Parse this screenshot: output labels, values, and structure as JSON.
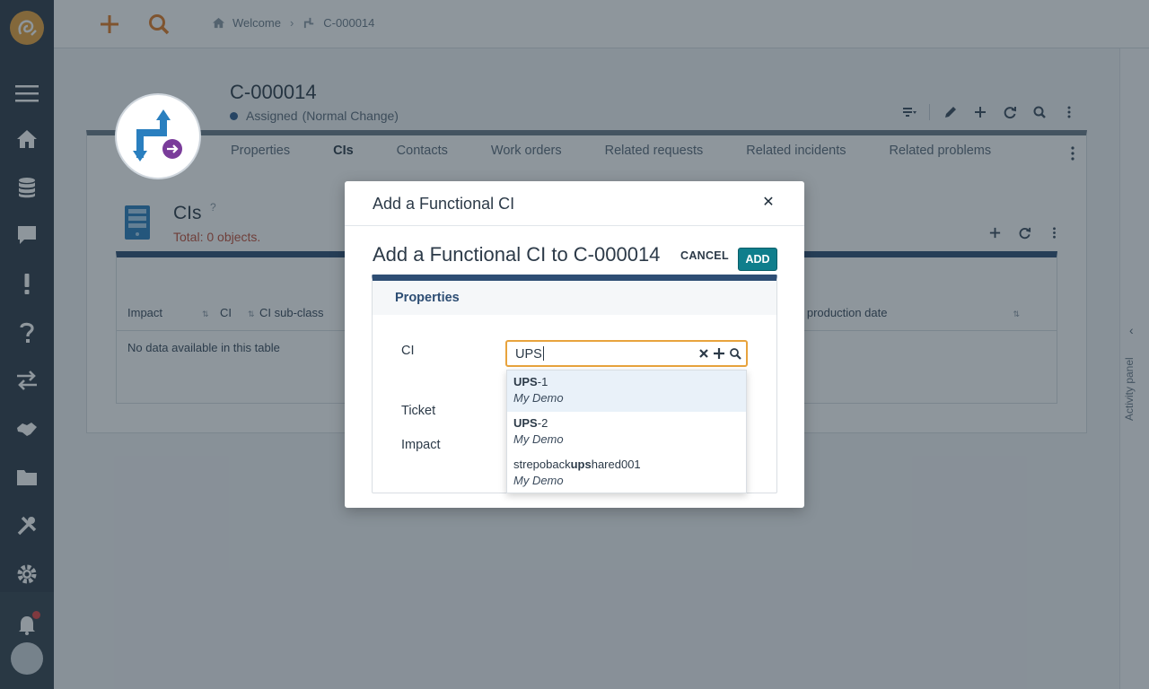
{
  "sidebar": {
    "items": [
      "menu-icon",
      "home-icon",
      "database-icon",
      "chat-icon",
      "alert-icon",
      "help-icon",
      "swap-icon",
      "handshake-icon",
      "folder-icon",
      "tools-icon",
      "gear-icon"
    ],
    "bottom": [
      "bell-icon",
      "avatar"
    ]
  },
  "topbar": {
    "breadcrumb": [
      {
        "label": "Welcome",
        "icon": "home-icon"
      },
      {
        "label": "C-000014",
        "icon": "change-icon"
      }
    ]
  },
  "object": {
    "title": "C-000014",
    "status": "Assigned",
    "status_detail": "(Normal Change)",
    "tabs": [
      "Properties",
      "CIs",
      "Contacts",
      "Work orders",
      "Related requests",
      "Related incidents",
      "Related problems"
    ],
    "active_tab": "CIs"
  },
  "cis_panel": {
    "title": "CIs",
    "help": "?",
    "total": "Total: 0  objects.",
    "columns": [
      "Impact",
      "CI",
      "CI sub-class",
      "o production date"
    ],
    "empty": "No data available in this table"
  },
  "activity_panel": {
    "label": "Activity panel"
  },
  "modal": {
    "title": "Add a Functional CI",
    "form_title": "Add a Functional CI to C-000014",
    "cancel": "CANCEL",
    "add": "ADD",
    "section": "Properties",
    "fields": {
      "ci": "CI",
      "ticket": "Ticket",
      "impact": "Impact"
    },
    "ci_value": "UPS",
    "suggestions": [
      {
        "pre": "",
        "match": "UPS",
        "post": "-1",
        "org": "My Demo"
      },
      {
        "pre": "",
        "match": "UPS",
        "post": "-2",
        "org": "My Demo"
      },
      {
        "pre": "strepoback",
        "match": "ups",
        "post": "hared001",
        "org": "My Demo"
      }
    ]
  },
  "colors": {
    "accent": "#e8a33d",
    "primary": "#2e4e74",
    "add_button": "#0f7e8c",
    "sidebar": "#2e3b48"
  }
}
